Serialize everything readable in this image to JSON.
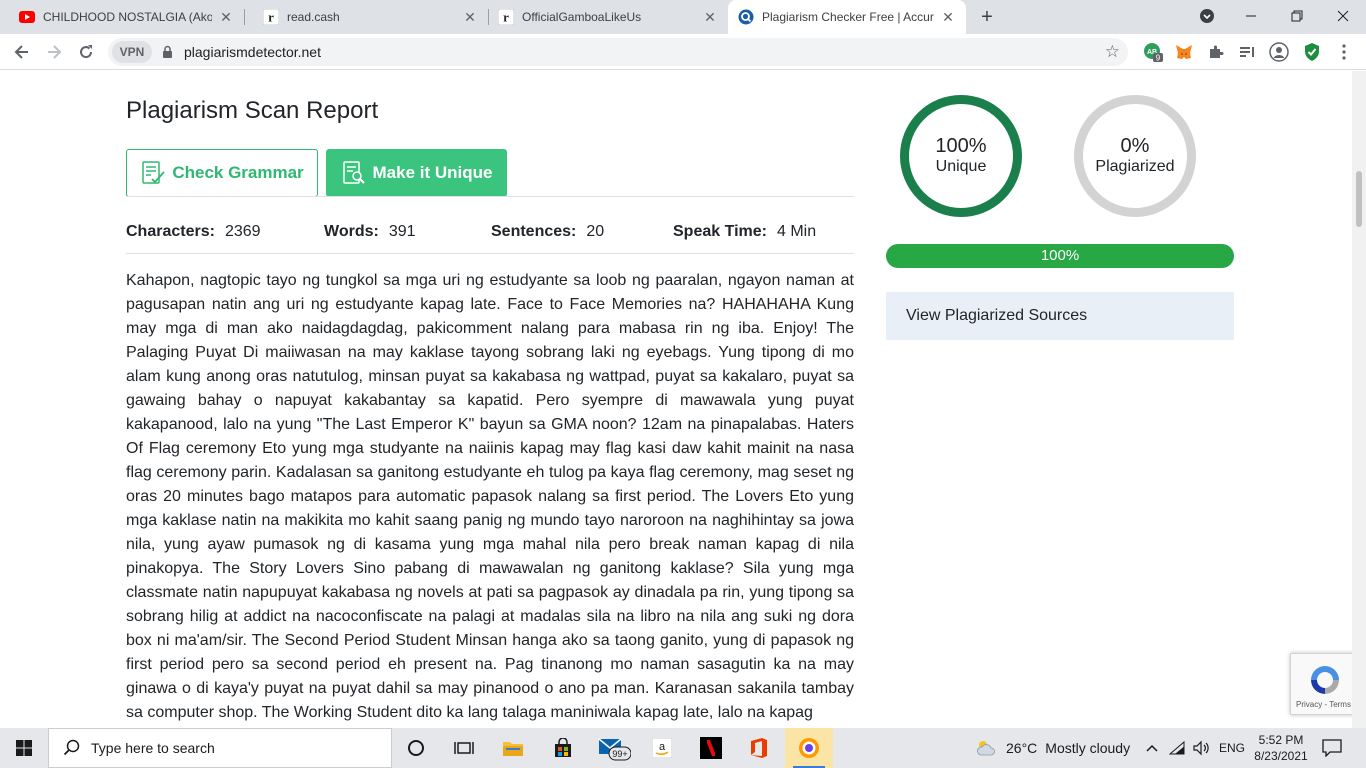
{
  "browser": {
    "tabs": [
      {
        "title": "CHILDHOOD NOSTALGIA (Akon,",
        "icon": "youtube-icon"
      },
      {
        "title": "read.cash",
        "icon": "read-cash-icon"
      },
      {
        "title": "OfficialGamboaLikeUs",
        "icon": "read-cash-icon"
      },
      {
        "title": "Plagiarism Checker Free | Accura",
        "icon": "plagiarism-detector-icon"
      }
    ],
    "vpn_label": "VPN",
    "url": "plagiarismdetector.net",
    "extension_badge": "9"
  },
  "page": {
    "title": "Plagiarism Scan Report",
    "check_grammar_label": "Check Grammar",
    "make_unique_label": "Make it Unique",
    "stats": {
      "characters_label": "Characters:",
      "characters_value": "2369",
      "words_label": "Words:",
      "words_value": "391",
      "sentences_label": "Sentences:",
      "sentences_value": "20",
      "speak_time_label": "Speak Time:",
      "speak_time_value": "4 Min"
    },
    "body_text": "Kahapon, nagtopic tayo ng tungkol sa mga uri ng estudyante sa loob ng paaralan, ngayon naman at pagusapan natin ang uri ng estudyante kapag late. Face to Face Memories na? HAHAHAHA Kung may mga di man ako naidagdagdag, pakicomment nalang para mabasa rin ng iba. Enjoy! The Palaging Puyat Di maiiwasan na may kaklase tayong sobrang laki ng eyebags. Yung tipong di mo alam kung anong oras natutulog, minsan puyat sa kakabasa ng wattpad, puyat sa kakalaro, puyat sa gawaing bahay o napuyat kakabantay sa kapatid. Pero syempre di mawawala yung puyat kakapanood, lalo na yung \"The Last Emperor K\" bayun sa GMA noon? 12am na pinapalabas. Haters Of Flag ceremony Eto yung mga studyante na naiinis kapag may flag kasi daw kahit mainit na nasa flag ceremony parin. Kadalasan sa ganitong estudyante eh tulog pa kaya flag ceremony, mag seset ng oras 20 minutes bago matapos para automatic papasok nalang sa first period. The Lovers Eto yung mga kaklase natin na makikita mo kahit saang panig ng mundo tayo naroroon na naghihintay sa jowa nila, yung ayaw pumasok ng di kasama yung mga mahal nila pero break naman kapag di nila pinakopya. The Story Lovers Sino pabang di mawawalan ng ganitong kaklase? Sila yung mga classmate natin napupuyat kakabasa ng novels at pati sa pagpasok ay dinadala pa rin, yung tipong sa sobrang hilig at addict na nacoconfiscate na palagi at madalas sila na libro na nila ang suki ng dora box ni ma'am/sir. The Second Period Student Minsan hanga ako sa taong ganito, yung di papasok ng first period pero sa second period eh present na. Pag tinanong mo naman sasagutin ka na may ginawa o di kaya'y puyat na puyat dahil sa may pinanood o ano pa man. Karanasan sakanila tambay sa computer shop. The Working Student dito ka lang talaga maniniwala kapag late, lalo na kapag",
    "unique_percent": "100%",
    "unique_label": "Unique",
    "plagiarized_percent": "0%",
    "plagiarized_label": "Plagiarized",
    "progress_value": 1.0,
    "progress_label": "100%",
    "view_sources_label": "View Plagiarized Sources",
    "recaptcha_links": "Privacy - Terms"
  },
  "colors": {
    "accent_green": "#3ac47d",
    "unique_ring": "#1a7f4b",
    "progress_green": "#28a745"
  },
  "taskbar": {
    "search_placeholder": "Type here to search",
    "mail_badge": "99+",
    "weather_temp": "26°C",
    "weather_desc": "Mostly cloudy",
    "language": "ENG",
    "time": "5:52 PM",
    "date": "8/23/2021"
  }
}
